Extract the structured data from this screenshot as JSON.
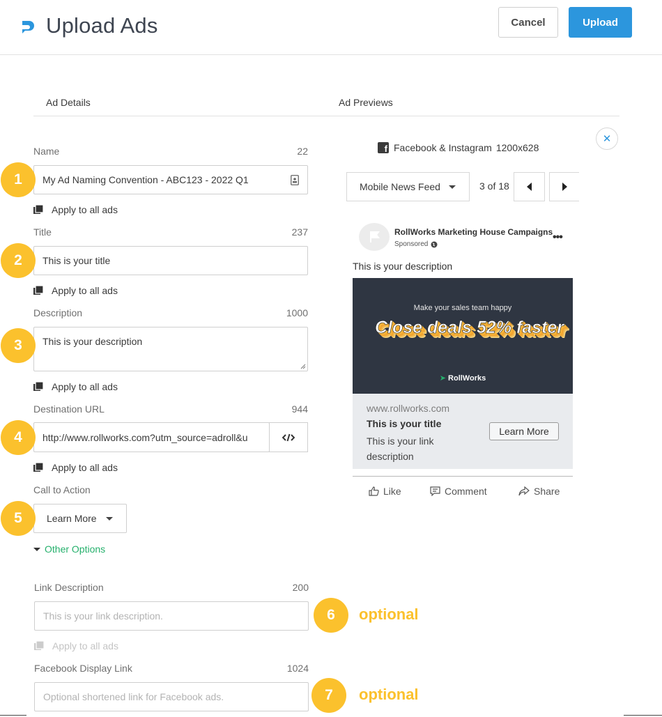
{
  "header": {
    "title": "Upload Ads",
    "cancel_label": "Cancel",
    "upload_label": "Upload"
  },
  "colors": {
    "primary": "#2c96dd",
    "badge": "#fbc12d",
    "link_green": "#25b06c"
  },
  "sections": {
    "details": "Ad Details",
    "previews": "Ad Previews"
  },
  "form": {
    "apply_label": "Apply to all ads",
    "name": {
      "label": "Name",
      "count": "22",
      "value": "My Ad Naming Convention - ABC123 - 2022 Q1"
    },
    "title": {
      "label": "Title",
      "count": "237",
      "value": "This is your title"
    },
    "description": {
      "label": "Description",
      "count": "1000",
      "value": "This is your description"
    },
    "url": {
      "label": "Destination URL",
      "count": "944",
      "value": "http://www.rollworks.com?utm_source=adroll&u"
    },
    "cta": {
      "label": "Call to Action",
      "value": "Learn More"
    },
    "other_options": "Other Options",
    "link_description": {
      "label": "Link Description",
      "count": "200",
      "placeholder": "This is your link description."
    },
    "display_link": {
      "label": "Facebook Display Link",
      "count": "1024",
      "placeholder": "Optional shortened link for Facebook ads."
    }
  },
  "badges": [
    "1",
    "2",
    "3",
    "4",
    "5",
    "6",
    "7"
  ],
  "optional_label": "optional",
  "preview": {
    "platform": "Facebook & Instagram",
    "size": "1200x628",
    "placement": "Mobile News Feed",
    "pager": "3 of 18",
    "page_name": "RollWorks Marketing House Campaigns",
    "sponsored": "Sponsored",
    "description": "This is your description",
    "creative": {
      "tagline": "Make your sales team happy",
      "headline": "Close deals 52% faster",
      "brand": "RollWorks"
    },
    "card": {
      "domain": "www.rollworks.com",
      "title": "This is your title",
      "description": "This is your link description",
      "cta": "Learn More"
    },
    "actions": {
      "like": "Like",
      "comment": "Comment",
      "share": "Share"
    }
  }
}
